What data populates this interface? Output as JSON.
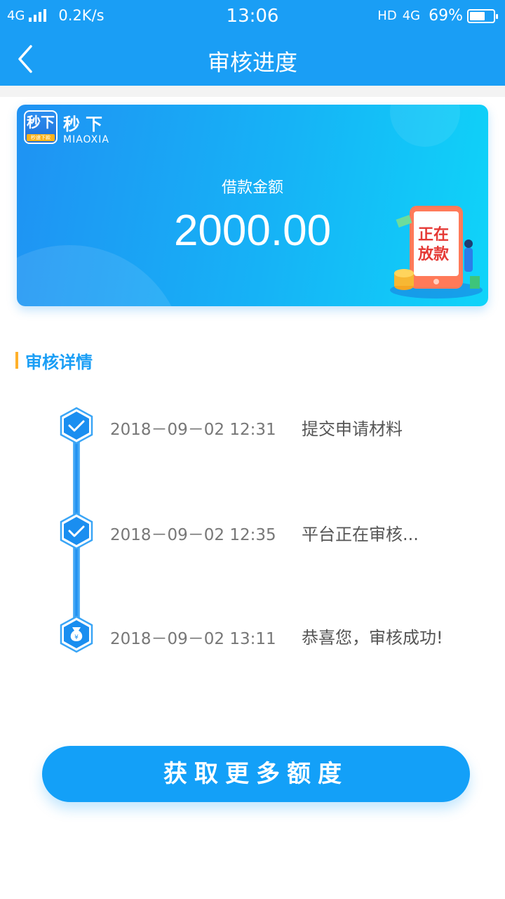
{
  "status_bar": {
    "network": "4G",
    "speed": "0.2K/s",
    "time": "13:06",
    "hd": "HD",
    "network_right": "4G",
    "battery": "69%",
    "battery_level": 0.69
  },
  "navbar": {
    "title": "审核进度"
  },
  "banner": {
    "brand_logo_text": "秒下",
    "brand_logo_sub": "秒速下款",
    "brand_name": "秒下",
    "brand_en": "MIAOXIA",
    "amount_label": "借款金额",
    "amount_value": "2000.00",
    "illustration_text_line1": "正在",
    "illustration_text_line2": "放款"
  },
  "section": {
    "title": "审核详情"
  },
  "timeline": [
    {
      "time": "2018－09－02  12:31",
      "text": "提交申请材料",
      "icon": "check-icon"
    },
    {
      "time": "2018－09－02  12:35",
      "text": "平台正在审核...",
      "icon": "check-icon"
    },
    {
      "time": "2018－09－02  13:11",
      "text": "恭喜您，审核成功!",
      "icon": "money-bag-icon"
    }
  ],
  "button": {
    "label": "获取更多额度"
  },
  "colors": {
    "primary": "#1a9ef5",
    "accent": "#ffb12b",
    "button": "#13a0f8"
  }
}
